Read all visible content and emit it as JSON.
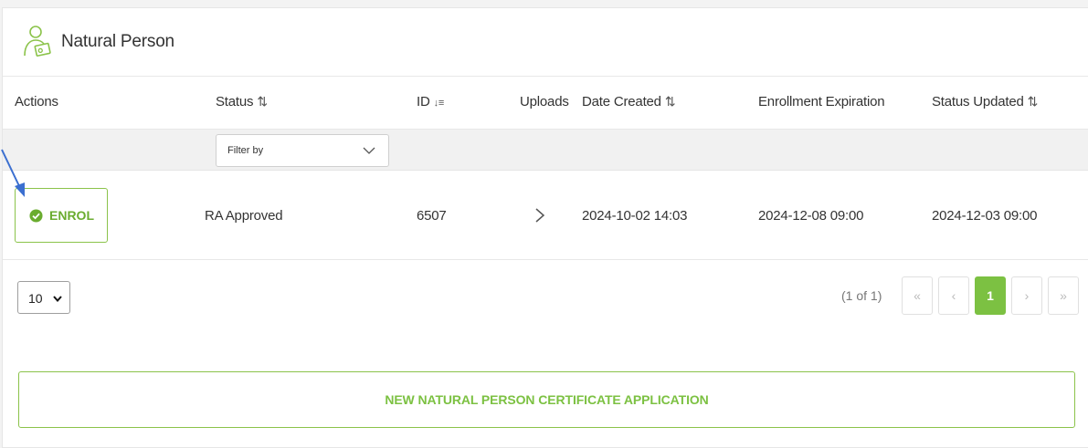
{
  "panel": {
    "title": "Natural Person",
    "icon": "person-id-icon"
  },
  "table": {
    "columns": [
      {
        "label": "Actions",
        "sort_icon": ""
      },
      {
        "label": "Status",
        "sort_icon": "⇅"
      },
      {
        "label": "ID",
        "sort_icon": "↓≡"
      },
      {
        "label": "Uploads",
        "sort_icon": ""
      },
      {
        "label": "Date Created",
        "sort_icon": "⇅"
      },
      {
        "label": "Enrollment Expiration",
        "sort_icon": ""
      },
      {
        "label": "Status Updated",
        "sort_icon": "⇅"
      }
    ],
    "filter": {
      "placeholder": "Filter by"
    },
    "rows": [
      {
        "action_label": "ENROL",
        "status": "RA Approved",
        "id": "6507",
        "date_created": "2024-10-02 14:03",
        "enrollment_expiration": "2024-12-08 09:00",
        "status_updated": "2024-12-03 09:00"
      }
    ]
  },
  "pagination": {
    "rows_per_page": "10",
    "page_info": "(1 of 1)",
    "first": "«",
    "prev": "‹",
    "current": "1",
    "next": "›",
    "last": "»"
  },
  "new_application": {
    "label": "NEW NATURAL PERSON CERTIFICATE APPLICATION"
  },
  "colors": {
    "accent": "#7cc142",
    "accent_border": "#8bc34a",
    "annotation_arrow": "#3b6fd0"
  }
}
